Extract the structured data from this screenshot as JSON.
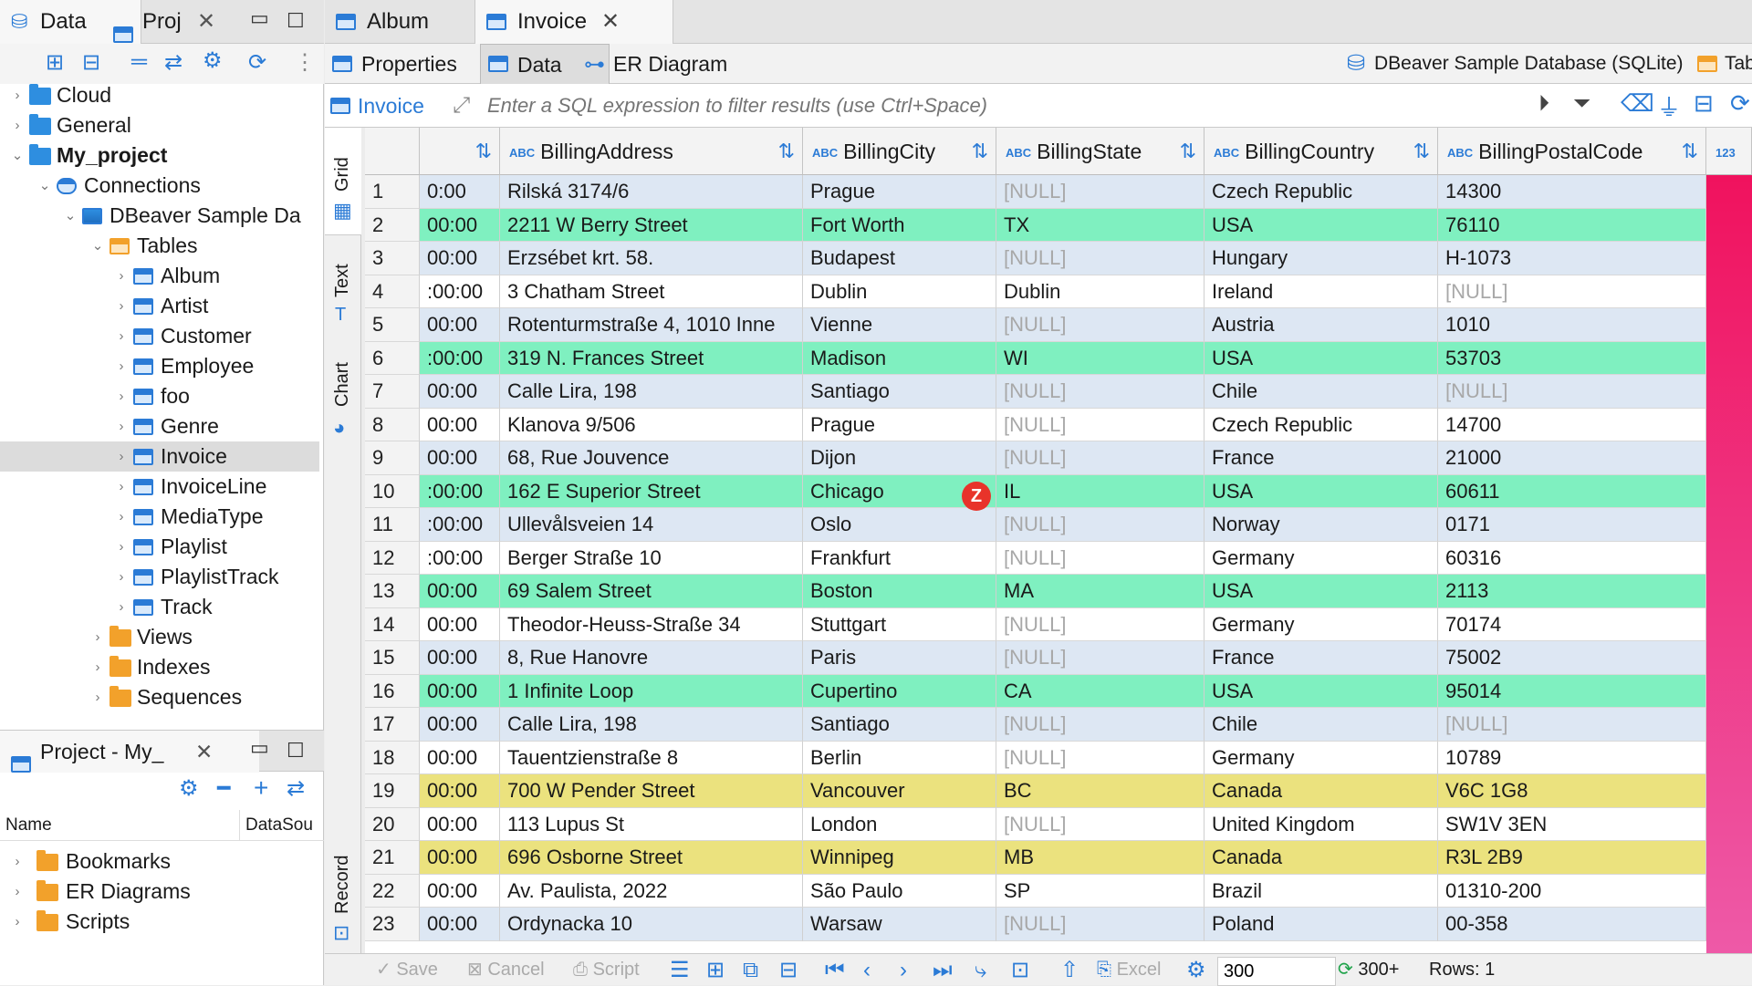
{
  "left_tabs": [
    {
      "label": "Data"
    },
    {
      "label": "Proj"
    }
  ],
  "tree": [
    {
      "label": "Cloud",
      "level": 0,
      "chev": "›",
      "icon": "folder-blue"
    },
    {
      "label": "General",
      "level": 0,
      "chev": "›",
      "icon": "folder-blue"
    },
    {
      "label": "My_project",
      "level": 0,
      "chev": "⌄",
      "icon": "folder-blue",
      "bold": true
    },
    {
      "label": "Connections",
      "level": 1,
      "chev": "⌄",
      "icon": "connections"
    },
    {
      "label": "DBeaver Sample Da",
      "level": 2,
      "chev": "⌄",
      "icon": "database"
    },
    {
      "label": "Tables",
      "level": 3,
      "chev": "⌄",
      "icon": "tables"
    },
    {
      "label": "Album",
      "level": 4,
      "chev": "›",
      "icon": "table"
    },
    {
      "label": "Artist",
      "level": 4,
      "chev": "›",
      "icon": "table"
    },
    {
      "label": "Customer",
      "level": 4,
      "chev": "›",
      "icon": "table"
    },
    {
      "label": "Employee",
      "level": 4,
      "chev": "›",
      "icon": "table"
    },
    {
      "label": "foo",
      "level": 4,
      "chev": "›",
      "icon": "table"
    },
    {
      "label": "Genre",
      "level": 4,
      "chev": "›",
      "icon": "table"
    },
    {
      "label": "Invoice",
      "level": 4,
      "chev": "›",
      "icon": "table",
      "selected": true
    },
    {
      "label": "InvoiceLine",
      "level": 4,
      "chev": "›",
      "icon": "table"
    },
    {
      "label": "MediaType",
      "level": 4,
      "chev": "›",
      "icon": "table"
    },
    {
      "label": "Playlist",
      "level": 4,
      "chev": "›",
      "icon": "table"
    },
    {
      "label": "PlaylistTrack",
      "level": 4,
      "chev": "›",
      "icon": "table"
    },
    {
      "label": "Track",
      "level": 4,
      "chev": "›",
      "icon": "table"
    },
    {
      "label": "Views",
      "level": 3,
      "chev": "›",
      "icon": "folder"
    },
    {
      "label": "Indexes",
      "level": 3,
      "chev": "›",
      "icon": "folder"
    },
    {
      "label": "Sequences",
      "level": 3,
      "chev": "›",
      "icon": "folder"
    }
  ],
  "project_panel": {
    "tab_label": "Project - My_",
    "col_name": "Name",
    "col_datasource": "DataSou",
    "items": [
      {
        "label": "Bookmarks"
      },
      {
        "label": "ER Diagrams"
      },
      {
        "label": "Scripts"
      }
    ]
  },
  "editor_tabs": [
    {
      "label": "Album",
      "active": false
    },
    {
      "label": "Invoice",
      "active": true
    }
  ],
  "sub_tabs": [
    {
      "label": "Properties"
    },
    {
      "label": "Data",
      "active": true
    },
    {
      "label": "ER Diagram"
    }
  ],
  "datasource_label": "DBeaver Sample Database (SQLite)",
  "tab_cut_label": "Tab",
  "filter": {
    "table_label": "Invoice",
    "placeholder": "Enter a SQL expression to filter results (use Ctrl+Space)"
  },
  "side_tabs": [
    "Grid",
    "Text",
    "Chart",
    "Record"
  ],
  "columns": [
    {
      "name": "",
      "type": ""
    },
    {
      "name": "BillingAddress",
      "type": "ABC"
    },
    {
      "name": "BillingCity",
      "type": "ABC"
    },
    {
      "name": "BillingState",
      "type": "ABC"
    },
    {
      "name": "BillingCountry",
      "type": "ABC"
    },
    {
      "name": "BillingPostalCode",
      "type": "ABC"
    },
    {
      "name": "",
      "type": "123"
    }
  ],
  "rows": [
    {
      "n": "1",
      "time": "0:00",
      "address": "Rilská 3174/6",
      "city": "Prague",
      "state": "[NULL]",
      "country": "Czech Republic",
      "postal": "14300"
    },
    {
      "n": "2",
      "time": "00:00",
      "address": "2211 W Berry Street",
      "city": "Fort Worth",
      "state": "TX",
      "country": "USA",
      "postal": "76110"
    },
    {
      "n": "3",
      "time": "00:00",
      "address": "Erzsébet krt. 58.",
      "city": "Budapest",
      "state": "[NULL]",
      "country": "Hungary",
      "postal": "H-1073"
    },
    {
      "n": "4",
      "time": ":00:00",
      "address": "3 Chatham Street",
      "city": "Dublin",
      "state": "Dublin",
      "country": "Ireland",
      "postal": "[NULL]"
    },
    {
      "n": "5",
      "time": "00:00",
      "address": "Rotenturmstraße 4, 1010 Inne",
      "city": "Vienne",
      "state": "[NULL]",
      "country": "Austria",
      "postal": "1010"
    },
    {
      "n": "6",
      "time": ":00:00",
      "address": "319 N. Frances Street",
      "city": "Madison",
      "state": "WI",
      "country": "USA",
      "postal": "53703"
    },
    {
      "n": "7",
      "time": "00:00",
      "address": "Calle Lira, 198",
      "city": "Santiago",
      "state": "[NULL]",
      "country": "Chile",
      "postal": "[NULL]"
    },
    {
      "n": "8",
      "time": "00:00",
      "address": "Klanova 9/506",
      "city": "Prague",
      "state": "[NULL]",
      "country": "Czech Republic",
      "postal": "14700"
    },
    {
      "n": "9",
      "time": "00:00",
      "address": "68, Rue Jouvence",
      "city": "Dijon",
      "state": "[NULL]",
      "country": "France",
      "postal": "21000"
    },
    {
      "n": "10",
      "time": ":00:00",
      "address": "162 E Superior Street",
      "city": "Chicago",
      "state": "IL",
      "country": "USA",
      "postal": "60611"
    },
    {
      "n": "11",
      "time": ":00:00",
      "address": "Ullevålsveien 14",
      "city": "Oslo",
      "state": "[NULL]",
      "country": "Norway",
      "postal": "0171"
    },
    {
      "n": "12",
      "time": ":00:00",
      "address": "Berger Straße 10",
      "city": "Frankfurt",
      "state": "[NULL]",
      "country": "Germany",
      "postal": "60316"
    },
    {
      "n": "13",
      "time": "00:00",
      "address": "69 Salem Street",
      "city": "Boston",
      "state": "MA",
      "country": "USA",
      "postal": "2113"
    },
    {
      "n": "14",
      "time": "00:00",
      "address": "Theodor-Heuss-Straße 34",
      "city": "Stuttgart",
      "state": "[NULL]",
      "country": "Germany",
      "postal": "70174"
    },
    {
      "n": "15",
      "time": "00:00",
      "address": "8, Rue Hanovre",
      "city": "Paris",
      "state": "[NULL]",
      "country": "France",
      "postal": "75002"
    },
    {
      "n": "16",
      "time": "00:00",
      "address": "1 Infinite Loop",
      "city": "Cupertino",
      "state": "CA",
      "country": "USA",
      "postal": "95014"
    },
    {
      "n": "17",
      "time": "00:00",
      "address": "Calle Lira, 198",
      "city": "Santiago",
      "state": "[NULL]",
      "country": "Chile",
      "postal": "[NULL]"
    },
    {
      "n": "18",
      "time": "00:00",
      "address": "Tauentzienstraße 8",
      "city": "Berlin",
      "state": "[NULL]",
      "country": "Germany",
      "postal": "10789"
    },
    {
      "n": "19",
      "time": "00:00",
      "address": "700 W Pender Street",
      "city": "Vancouver",
      "state": "BC",
      "country": "Canada",
      "postal": "V6C 1G8"
    },
    {
      "n": "20",
      "time": "00:00",
      "address": "113 Lupus St",
      "city": "London",
      "state": "[NULL]",
      "country": "United Kingdom",
      "postal": "SW1V 3EN"
    },
    {
      "n": "21",
      "time": "00:00",
      "address": "696 Osborne Street",
      "city": "Winnipeg",
      "state": "MB",
      "country": "Canada",
      "postal": "R3L 2B9"
    },
    {
      "n": "22",
      "time": "00:00",
      "address": "Av. Paulista, 2022",
      "city": "São Paulo",
      "state": "SP",
      "country": "Brazil",
      "postal": "01310-200"
    },
    {
      "n": "23",
      "time": "00:00",
      "address": "Ordynacka 10",
      "city": "Warsaw",
      "state": "[NULL]",
      "country": "Poland",
      "postal": "00-358"
    }
  ],
  "status": {
    "save": "Save",
    "cancel": "Cancel",
    "script": "Script",
    "excel": "Excel",
    "fetch_size": "300",
    "fetched": "300+",
    "rows": "Rows: 1"
  },
  "colors": {
    "usa_row": "#7ff0c0",
    "canada_row": "#ebe27e",
    "stripe": "#dde7f3",
    "accent": "#2b7bd6"
  }
}
